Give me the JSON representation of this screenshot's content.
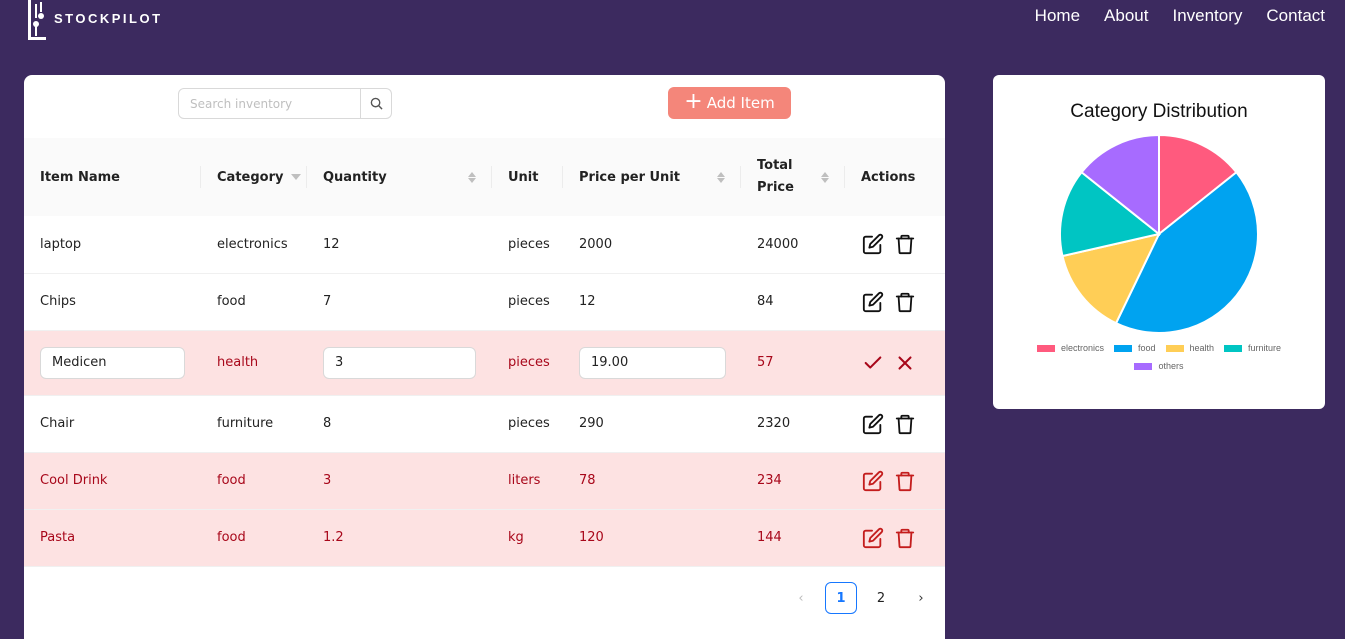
{
  "brand": {
    "name": "STOCKPILOT"
  },
  "nav": {
    "items": [
      "Home",
      "About",
      "Inventory",
      "Contact"
    ]
  },
  "toolbar": {
    "search_placeholder": "Search inventory",
    "add_label": "Add Item"
  },
  "table": {
    "headers": [
      "Item Name",
      "Category",
      "Quantity",
      "Unit",
      "Price per Unit",
      "Total Price",
      "Actions"
    ],
    "rows": [
      {
        "name": "laptop",
        "category": "electronics",
        "quantity": "12",
        "unit": "pieces",
        "price": "2000",
        "total": "24000",
        "state": "normal"
      },
      {
        "name": "Chips",
        "category": "food",
        "quantity": "7",
        "unit": "pieces",
        "price": "12",
        "total": "84",
        "state": "normal"
      },
      {
        "name": "Medicen",
        "category": "health",
        "quantity": "3",
        "unit": "pieces",
        "price": "19.00",
        "total": "57",
        "state": "editing"
      },
      {
        "name": "Chair",
        "category": "furniture",
        "quantity": "8",
        "unit": "pieces",
        "price": "290",
        "total": "2320",
        "state": "normal"
      },
      {
        "name": "Cool Drink",
        "category": "food",
        "quantity": "3",
        "unit": "liters",
        "price": "78",
        "total": "234",
        "state": "alert"
      },
      {
        "name": "Pasta",
        "category": "food",
        "quantity": "1.2",
        "unit": "kg",
        "price": "120",
        "total": "144",
        "state": "alert"
      }
    ]
  },
  "pagination": {
    "pages": [
      "1",
      "2"
    ],
    "current": "1"
  },
  "chart_data": {
    "type": "pie",
    "title": "Category Distribution",
    "categories": [
      "electronics",
      "food",
      "health",
      "furniture",
      "others"
    ],
    "values": [
      14.3,
      42.9,
      14.3,
      14.3,
      14.3
    ],
    "colors": [
      "#ff5a7e",
      "#00a3f0",
      "#ffce56",
      "#00c5c3",
      "#a76bff"
    ],
    "legend_position": "bottom"
  }
}
